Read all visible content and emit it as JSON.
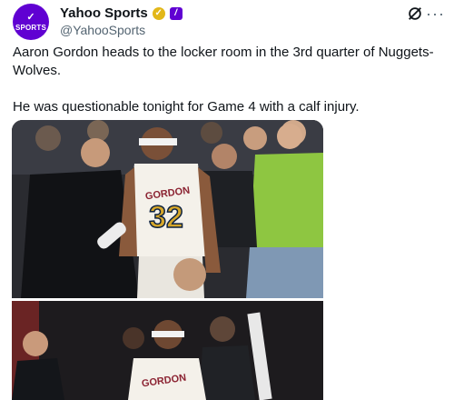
{
  "author": {
    "name": "Yahoo Sports",
    "handle": "@YahooSports",
    "avatar_text": "SPORTS",
    "avatar_icon": "checkmark-logo-icon"
  },
  "tweet": {
    "line1": "Aaron Gordon heads to the locker room in the 3rd quarter of Nuggets-Wolves.",
    "line2": "He was questionable tonight for Game 4 with a calf injury."
  },
  "media": {
    "jersey_name": "GORDON",
    "jersey_number": "32",
    "jersey_name_lower": "GORDON"
  },
  "colors": {
    "brand": "#6001d2",
    "verified": "#e2b719",
    "muted": "#536471"
  },
  "icons": [
    "grok-icon",
    "more-icon",
    "verified-badge-icon",
    "yahoo-affiliate-icon"
  ]
}
